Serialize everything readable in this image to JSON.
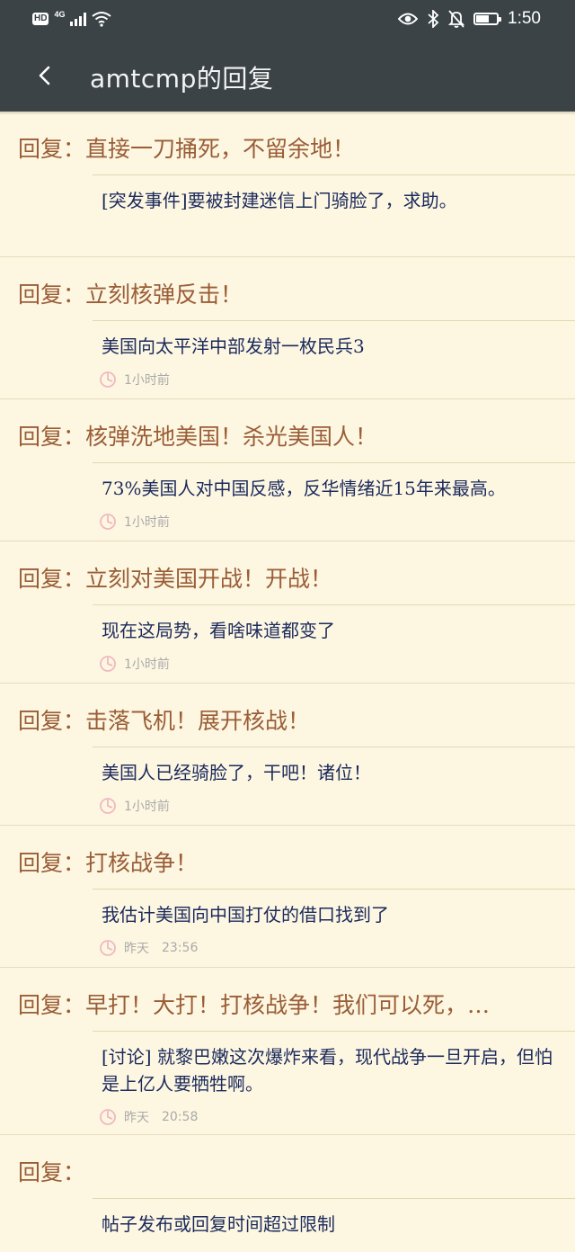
{
  "status_bar": {
    "hd": "HD",
    "network": "4G",
    "time": "1:50"
  },
  "header": {
    "title": "amtcmp的回复"
  },
  "replies": [
    {
      "prefix": "回复：",
      "content": "直接一刀捅死，不留余地！",
      "post_title": "[突发事件]要被封建迷信上门骑脸了，求助。",
      "date": "",
      "time": ""
    },
    {
      "prefix": "回复：",
      "content": "立刻核弹反击！",
      "post_title": "美国向太平洋中部发射一枚民兵3",
      "date": "1小时前",
      "time": ""
    },
    {
      "prefix": "回复：",
      "content": "核弹洗地美国！杀光美国人！",
      "post_title": "73%美国人对中国反感，反华情绪近15年来最高。",
      "date": "1小时前",
      "time": ""
    },
    {
      "prefix": "回复：",
      "content": "立刻对美国开战！开战！",
      "post_title": "现在这局势，看啥味道都变了",
      "date": "1小时前",
      "time": ""
    },
    {
      "prefix": "回复：",
      "content": "击落飞机！展开核战！",
      "post_title": "美国人已经骑脸了，干吧！诸位！",
      "date": "1小时前",
      "time": ""
    },
    {
      "prefix": "回复：",
      "content": "打核战争！",
      "post_title": "我估计美国向中国打仗的借口找到了",
      "date": "昨天",
      "time": "23:56"
    },
    {
      "prefix": "回复：",
      "content": "早打！大打！打核战争！我们可以死，…",
      "post_title": "[讨论] 就黎巴嫩这次爆炸来看，现代战争一旦开启，但怕是上亿人要牺牲啊。",
      "date": "昨天",
      "time": "20:58"
    },
    {
      "prefix": "回复：",
      "content": "",
      "post_title": "帖子发布或回复时间超过限制",
      "date": "",
      "time": ""
    }
  ],
  "colors": {
    "background": "#fdf7e2",
    "header": "#3b4347",
    "reply_text": "#9a5d36",
    "post_title": "#1c2a5c",
    "meta": "#a9a9a9",
    "clock_icon": "#f0b8c0"
  }
}
